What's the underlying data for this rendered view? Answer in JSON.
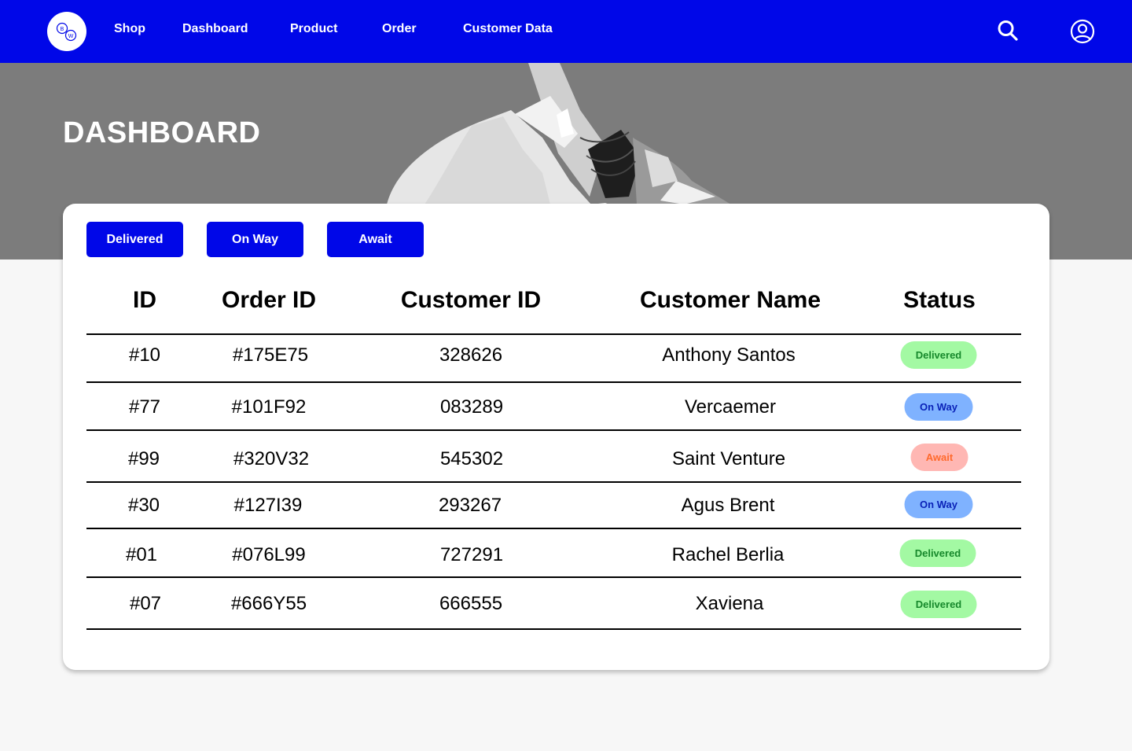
{
  "nav": {
    "links": [
      "Shop",
      "Dashboard",
      "Product",
      "Order",
      "Customer Data"
    ],
    "icons": {
      "search": "search-icon",
      "account": "user-circle-icon",
      "logo": "bw-logo"
    }
  },
  "hero": {
    "title": "DASHBOARD"
  },
  "filters": [
    "Delivered",
    "On Way",
    "Await"
  ],
  "table": {
    "headers": [
      "ID",
      "Order ID",
      "Customer ID",
      "Customer Name",
      "Status"
    ],
    "rows": [
      {
        "id": "#10",
        "order_id": "#175E75",
        "customer_id": "328626",
        "name": "Anthony Santos",
        "status": "Delivered"
      },
      {
        "id": "#77",
        "order_id": "#101F92",
        "customer_id": "083289",
        "name": "Vercaemer",
        "status": "On Way"
      },
      {
        "id": "#99",
        "order_id": "#320V32",
        "customer_id": "545302",
        "name": "Saint Venture",
        "status": "Await"
      },
      {
        "id": "#30",
        "order_id": "#127I39",
        "customer_id": "293267",
        "name": "Agus Brent",
        "status": "On Way"
      },
      {
        "id": "#01",
        "order_id": "#076L99",
        "customer_id": "727291",
        "name": "Rachel Berlia",
        "status": "Delivered"
      },
      {
        "id": "#07",
        "order_id": "#666Y55",
        "customer_id": "666555",
        "name": "Xaviena",
        "status": "Delivered"
      }
    ]
  },
  "colors": {
    "brand": "#0007e8",
    "delivered_bg": "#a3f9a3",
    "delivered_fg": "#16882b",
    "onway_bg": "#7fb2ff",
    "onway_fg": "#0a22b8",
    "await_bg": "#ffb7b3",
    "await_fg": "#ff6a2d"
  }
}
